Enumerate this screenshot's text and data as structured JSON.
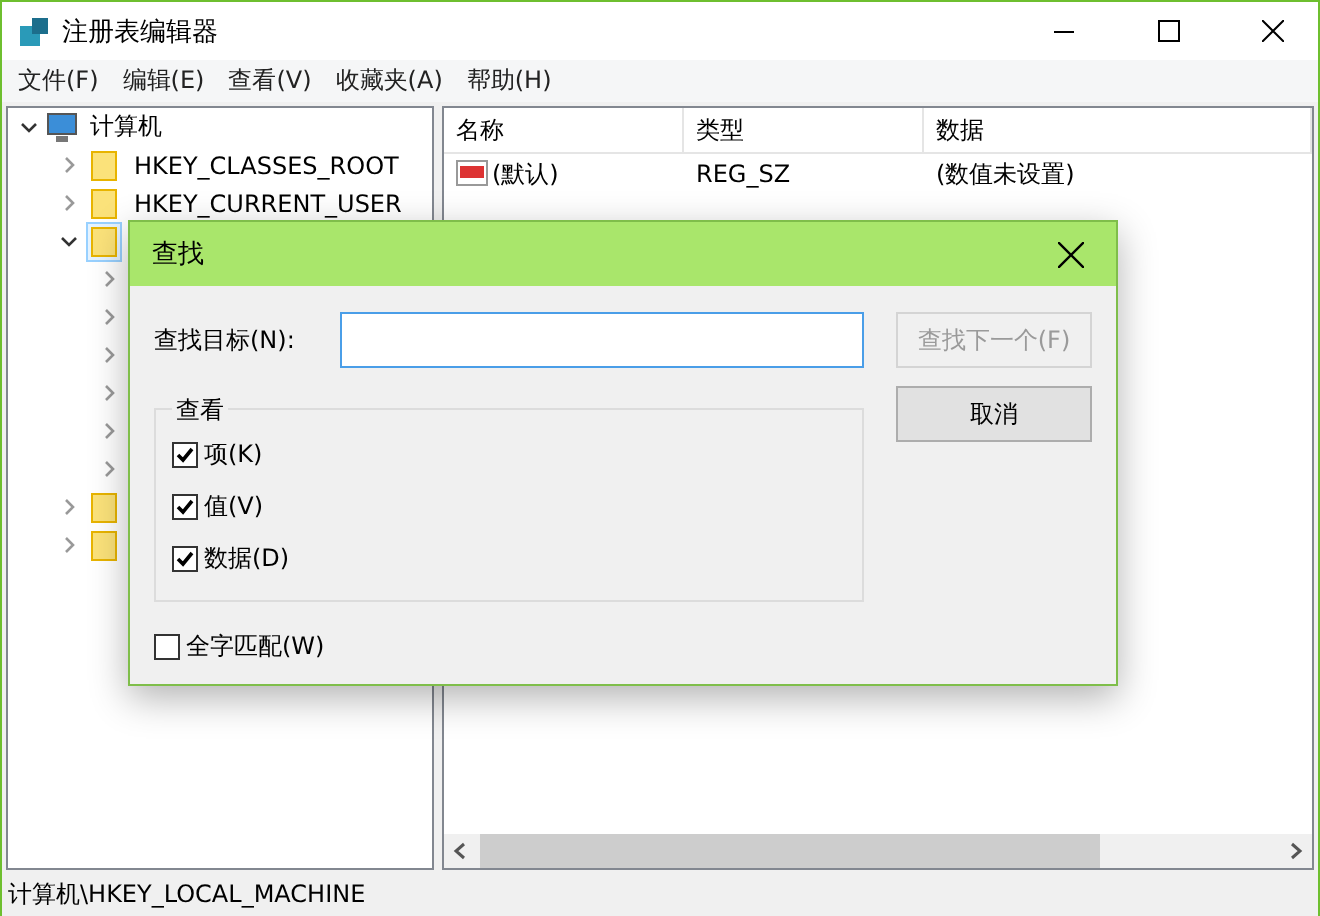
{
  "window": {
    "title": "注册表编辑器"
  },
  "menu": [
    "文件(F)",
    "编辑(E)",
    "查看(V)",
    "收藏夹(A)",
    "帮助(H)"
  ],
  "tree": {
    "label": "计算机",
    "expanded": true,
    "children": [
      {
        "label": "HKEY_CLASSES_ROOT",
        "expanded": false
      },
      {
        "label": "HKEY_CURRENT_USER",
        "expanded": false
      },
      {
        "expanded": true,
        "selected": true,
        "children": [
          {
            "expanded": false
          },
          {
            "expanded": false
          },
          {
            "expanded": false
          },
          {
            "expanded": false
          },
          {
            "expanded": false
          },
          {
            "expanded": false
          }
        ]
      },
      {
        "expanded": false
      },
      {
        "expanded": false
      }
    ]
  },
  "list": {
    "columns": [
      "名称",
      "类型",
      "数据"
    ],
    "rows": [
      {
        "name": "(默认)",
        "type": "REG_SZ",
        "data": "(数值未设置)"
      }
    ]
  },
  "status_bar": "计算机\\HKEY_LOCAL_MACHINE",
  "dialog": {
    "title": "查找",
    "target_label": "查找目标(N):",
    "group": "查看",
    "options": [
      {
        "label": "项(K)",
        "checked": true
      },
      {
        "label": "值(V)",
        "checked": true
      },
      {
        "label": "数据(D)",
        "checked": true
      }
    ],
    "whole_word": {
      "label": "全字匹配(W)",
      "checked": false
    },
    "buttons": [
      {
        "label": "查找下一个(F)",
        "disabled": true
      },
      {
        "label": "取消",
        "disabled": false
      }
    ]
  }
}
